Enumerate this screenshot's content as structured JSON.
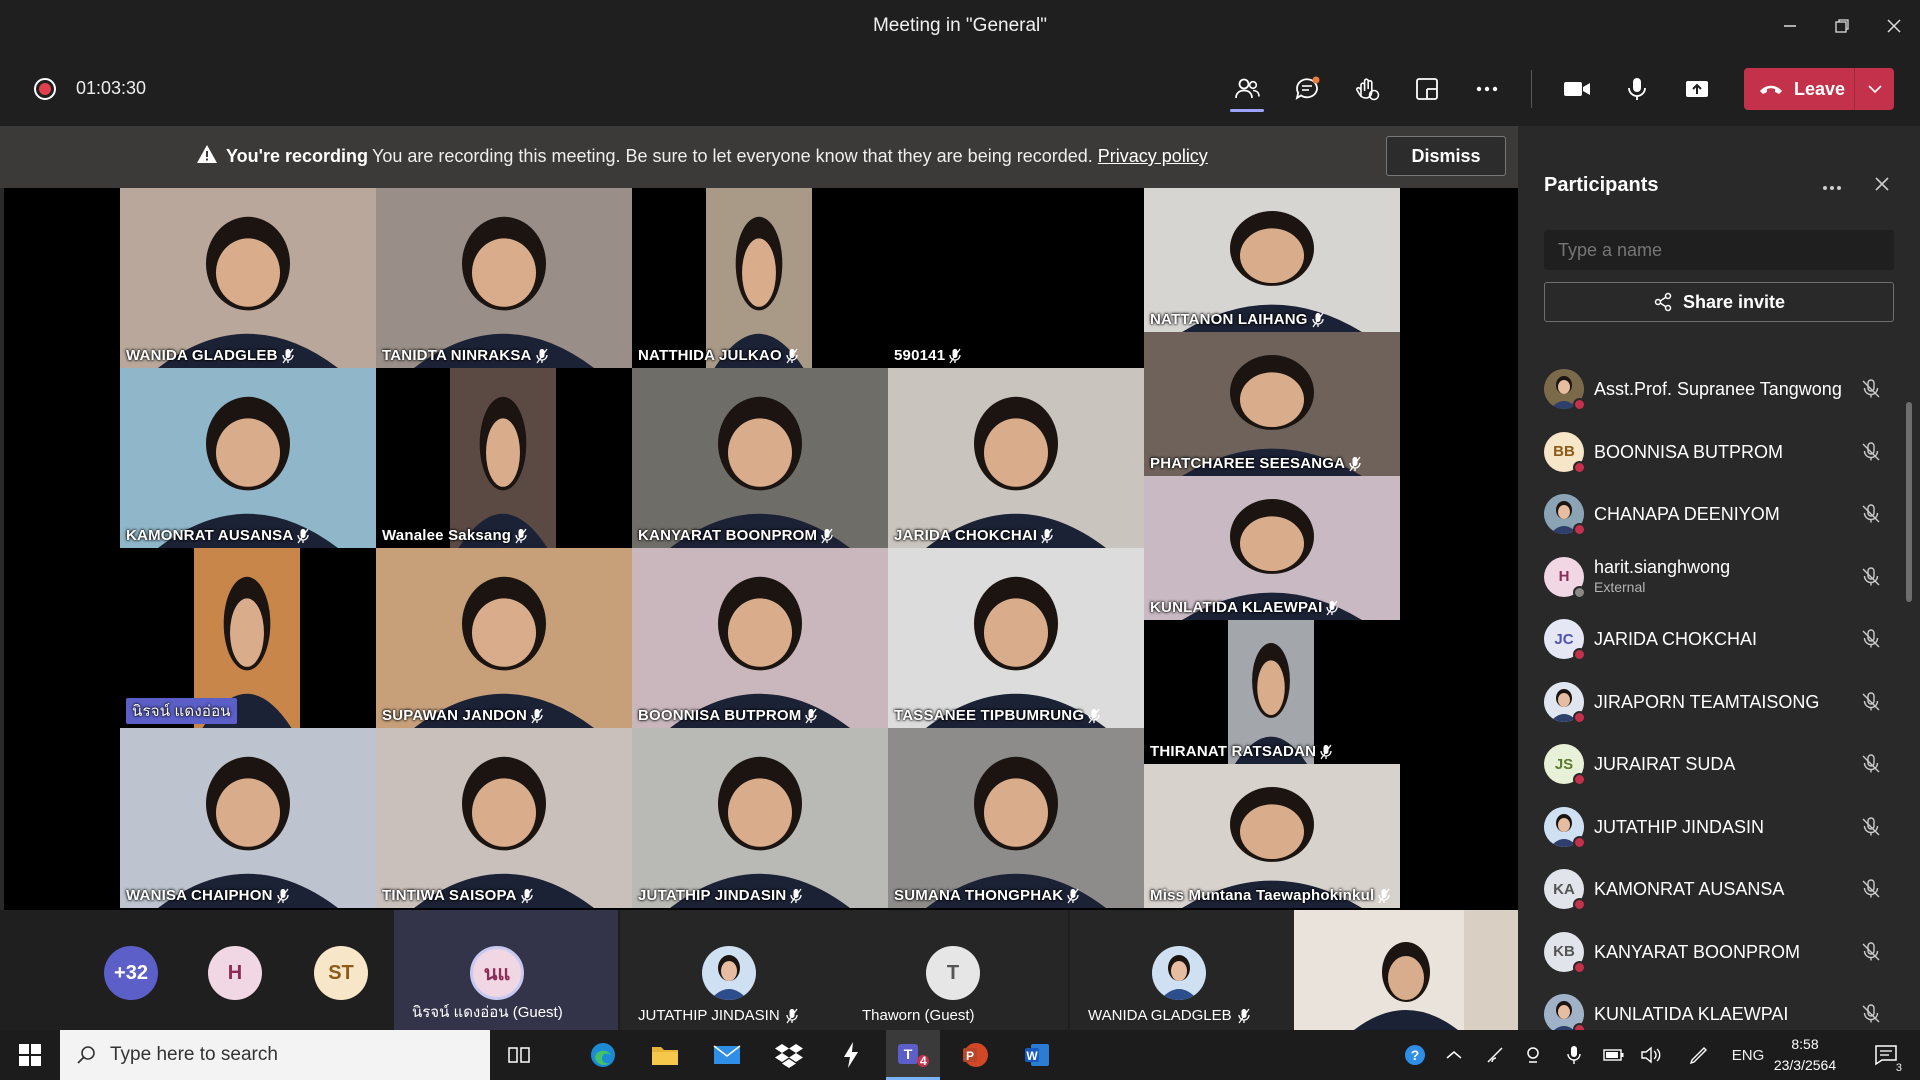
{
  "window": {
    "title": "Meeting in \"General\""
  },
  "toolbar": {
    "timer": "01:03:30",
    "leave_label": "Leave"
  },
  "banner": {
    "bold": "You're recording",
    "message": "You are recording this meeting. Be sure to let everyone know that they are being recorded.",
    "link": "Privacy policy",
    "dismiss": "Dismiss"
  },
  "grid": [
    {
      "name": "WANIDA GLADGLEB",
      "bg": "#b8a79a"
    },
    {
      "name": "TANIDTA NINRAKSA",
      "bg": "#9a8f88"
    },
    {
      "name": "NATTHIDA JULKAO",
      "bg": "#a89a86"
    },
    {
      "name": "590141",
      "bg": "#cfcfcf"
    },
    {
      "name": "NATTANON LAIHANG",
      "bg": "#d7d5d2"
    },
    {
      "name": "KAMONRAT AUSANSA",
      "bg": "#8fb6c9"
    },
    {
      "name": "Wanalee Saksang",
      "bg": "#5b4a44"
    },
    {
      "name": "KANYARAT BOONPROM",
      "bg": "#6f6d68"
    },
    {
      "name": "JARIDA CHOKCHAI",
      "bg": "#c9c4bd"
    },
    {
      "name": "PHATCHAREE SEESANGA",
      "bg": "#6e625a"
    },
    {
      "name": "KUNLATIDA KLAEWPAI",
      "bg": "#c9b9c2"
    },
    {
      "name": "นิรจน์ แดงอ่อน",
      "bg": "#c9864b"
    },
    {
      "name": "SUPAWAN JANDON",
      "bg": "#c7a07a"
    },
    {
      "name": "BOONNISA BUTPROM",
      "bg": "#c9b7bd"
    },
    {
      "name": "TASSANEE TIPBUMRUNG",
      "bg": "#dcdcdc"
    },
    {
      "name": "THIRANAT RATSADAN",
      "bg": "#a3a6ab"
    },
    {
      "name": "WANISA CHAIPHON",
      "bg": "#bdc4cf"
    },
    {
      "name": "TINTIWA SAISOPA",
      "bg": "#c9c0bb"
    },
    {
      "name": "JUTATHIP JINDASIN",
      "bg": "#b9b9b6"
    },
    {
      "name": "SUMANA THONGPHAK",
      "bg": "#8d8c8b"
    },
    {
      "name": "Miss Muntana Taewaphokinkul",
      "bg": "#d8d2cd"
    }
  ],
  "strip": {
    "overflow_count": "+32",
    "bubbles": [
      {
        "initials": "H",
        "bg": "#f1d6e3",
        "fg": "#8b2d56"
      },
      {
        "initials": "ST",
        "bg": "#f7e6c7",
        "fg": "#8a5b1a"
      }
    ],
    "tiles": [
      {
        "initials": "นแ",
        "name": "นิรจน์ แดงอ่อน (Guest)"
      },
      {
        "initials": "",
        "name": "JUTATHIP JINDASIN"
      },
      {
        "initials": "T",
        "name": "Thaworn (Guest)"
      },
      {
        "initials": "",
        "name": "WANIDA GLADGLEB"
      }
    ]
  },
  "panel": {
    "title": "Participants",
    "search_placeholder": "Type a name",
    "share_label": "Share invite",
    "participants": [
      {
        "initials": "",
        "name": "Asst.Prof. Supranee Tangwong",
        "sub": "",
        "bg": "#7a6a4a",
        "fg": "#fff"
      },
      {
        "initials": "BB",
        "name": "BOONNISA BUTPROM",
        "sub": "",
        "bg": "#f7e6c7",
        "fg": "#8a5b1a"
      },
      {
        "initials": "",
        "name": "CHANAPA DEENIYOM",
        "sub": "",
        "bg": "#8aa3b5",
        "fg": "#fff"
      },
      {
        "initials": "H",
        "name": "harit.sianghwong",
        "sub": "External",
        "bg": "#f1d6e3",
        "fg": "#8b2d56"
      },
      {
        "initials": "JC",
        "name": "JARIDA CHOKCHAI",
        "sub": "",
        "bg": "#e6e7f5",
        "fg": "#4f52b2"
      },
      {
        "initials": "",
        "name": "JIRAPORN TEAMTAISONG",
        "sub": "",
        "bg": "#dfe6f0",
        "fg": "#333"
      },
      {
        "initials": "JS",
        "name": "JURAIRAT SUDA",
        "sub": "",
        "bg": "#e7f1d8",
        "fg": "#5b7a2a"
      },
      {
        "initials": "",
        "name": "JUTATHIP JINDASIN",
        "sub": "",
        "bg": "#cfe0f3",
        "fg": "#333"
      },
      {
        "initials": "KA",
        "name": "KAMONRAT AUSANSA",
        "sub": "",
        "bg": "#e1e4ea",
        "fg": "#555"
      },
      {
        "initials": "KB",
        "name": "KANYARAT BOONPROM",
        "sub": "",
        "bg": "#e1e4ea",
        "fg": "#555"
      },
      {
        "initials": "",
        "name": "KUNLATIDA KLAEWPAI",
        "sub": "",
        "bg": "#9fb2c7",
        "fg": "#fff"
      }
    ]
  },
  "taskbar": {
    "search_placeholder": "Type here to search",
    "teams_badge": "4",
    "lang": "ENG",
    "time": "8:58",
    "date": "23/3/2564",
    "notif_count": "3"
  }
}
